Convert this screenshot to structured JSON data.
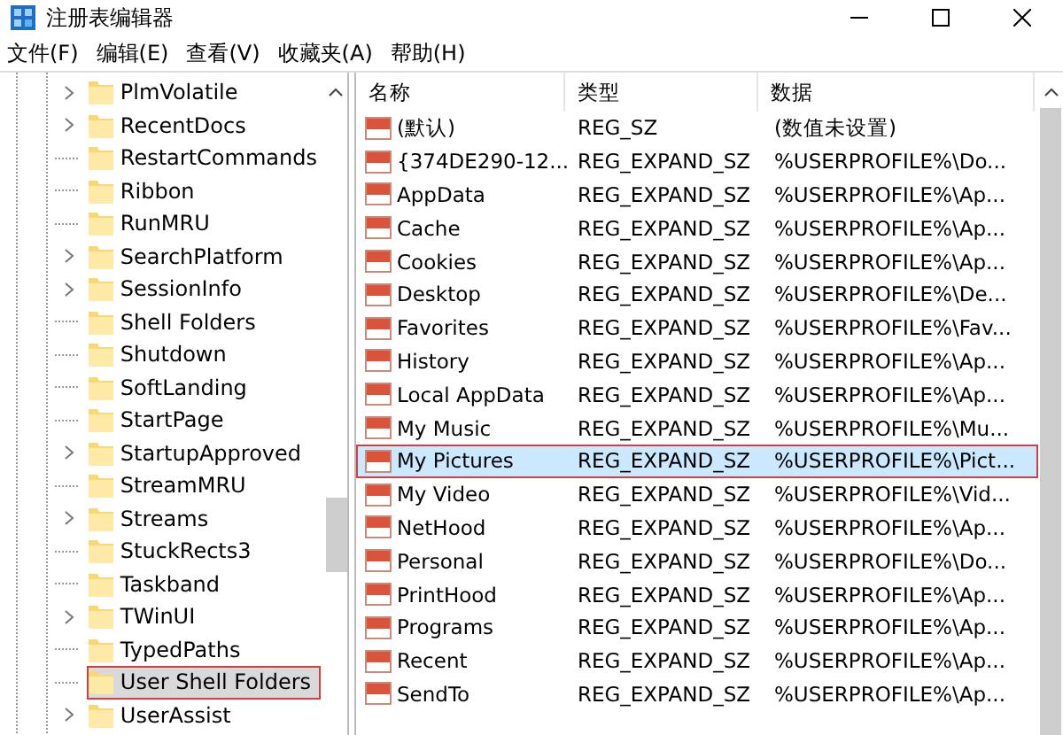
{
  "window": {
    "title": "注册表编辑器"
  },
  "menu": [
    "文件(F)",
    "编辑(E)",
    "查看(V)",
    "收藏夹(A)",
    "帮助(H)"
  ],
  "tree": {
    "items": [
      {
        "label": "PlmVolatile",
        "expandable": true,
        "selected": false
      },
      {
        "label": "RecentDocs",
        "expandable": true,
        "selected": false
      },
      {
        "label": "RestartCommands",
        "expandable": false,
        "selected": false
      },
      {
        "label": "Ribbon",
        "expandable": false,
        "selected": false
      },
      {
        "label": "RunMRU",
        "expandable": false,
        "selected": false
      },
      {
        "label": "SearchPlatform",
        "expandable": true,
        "selected": false
      },
      {
        "label": "SessionInfo",
        "expandable": true,
        "selected": false
      },
      {
        "label": "Shell Folders",
        "expandable": false,
        "selected": false
      },
      {
        "label": "Shutdown",
        "expandable": false,
        "selected": false
      },
      {
        "label": "SoftLanding",
        "expandable": false,
        "selected": false
      },
      {
        "label": "StartPage",
        "expandable": false,
        "selected": false
      },
      {
        "label": "StartupApproved",
        "expandable": true,
        "selected": false
      },
      {
        "label": "StreamMRU",
        "expandable": false,
        "selected": false
      },
      {
        "label": "Streams",
        "expandable": true,
        "selected": false
      },
      {
        "label": "StuckRects3",
        "expandable": false,
        "selected": false
      },
      {
        "label": "Taskband",
        "expandable": false,
        "selected": false
      },
      {
        "label": "TWinUI",
        "expandable": true,
        "selected": false
      },
      {
        "label": "TypedPaths",
        "expandable": false,
        "selected": false
      },
      {
        "label": "User Shell Folders",
        "expandable": false,
        "selected": true
      },
      {
        "label": "UserAssist",
        "expandable": true,
        "selected": false
      }
    ]
  },
  "list": {
    "columns": [
      "名称",
      "类型",
      "数据"
    ],
    "rows": [
      {
        "name": "(默认)",
        "type": "REG_SZ",
        "data": "(数值未设置)",
        "selected": false
      },
      {
        "name": "{374DE290-12...",
        "type": "REG_EXPAND_SZ",
        "data": "%USERPROFILE%\\Do...",
        "selected": false
      },
      {
        "name": "AppData",
        "type": "REG_EXPAND_SZ",
        "data": "%USERPROFILE%\\Ap...",
        "selected": false
      },
      {
        "name": "Cache",
        "type": "REG_EXPAND_SZ",
        "data": "%USERPROFILE%\\Ap...",
        "selected": false
      },
      {
        "name": "Cookies",
        "type": "REG_EXPAND_SZ",
        "data": "%USERPROFILE%\\Ap...",
        "selected": false
      },
      {
        "name": "Desktop",
        "type": "REG_EXPAND_SZ",
        "data": "%USERPROFILE%\\De...",
        "selected": false
      },
      {
        "name": "Favorites",
        "type": "REG_EXPAND_SZ",
        "data": "%USERPROFILE%\\Fav...",
        "selected": false
      },
      {
        "name": "History",
        "type": "REG_EXPAND_SZ",
        "data": "%USERPROFILE%\\Ap...",
        "selected": false
      },
      {
        "name": "Local AppData",
        "type": "REG_EXPAND_SZ",
        "data": "%USERPROFILE%\\Ap...",
        "selected": false
      },
      {
        "name": "My Music",
        "type": "REG_EXPAND_SZ",
        "data": "%USERPROFILE%\\Mu...",
        "selected": false
      },
      {
        "name": "My Pictures",
        "type": "REG_EXPAND_SZ",
        "data": "%USERPROFILE%\\Pict...",
        "selected": true
      },
      {
        "name": "My Video",
        "type": "REG_EXPAND_SZ",
        "data": "%USERPROFILE%\\Vid...",
        "selected": false
      },
      {
        "name": "NetHood",
        "type": "REG_EXPAND_SZ",
        "data": "%USERPROFILE%\\Ap...",
        "selected": false
      },
      {
        "name": "Personal",
        "type": "REG_EXPAND_SZ",
        "data": "%USERPROFILE%\\Do...",
        "selected": false
      },
      {
        "name": "PrintHood",
        "type": "REG_EXPAND_SZ",
        "data": "%USERPROFILE%\\Ap...",
        "selected": false
      },
      {
        "name": "Programs",
        "type": "REG_EXPAND_SZ",
        "data": "%USERPROFILE%\\Ap...",
        "selected": false
      },
      {
        "name": "Recent",
        "type": "REG_EXPAND_SZ",
        "data": "%USERPROFILE%\\Ap...",
        "selected": false
      },
      {
        "name": "SendTo",
        "type": "REG_EXPAND_SZ",
        "data": "%USERPROFILE%\\Ap...",
        "selected": false
      }
    ]
  }
}
